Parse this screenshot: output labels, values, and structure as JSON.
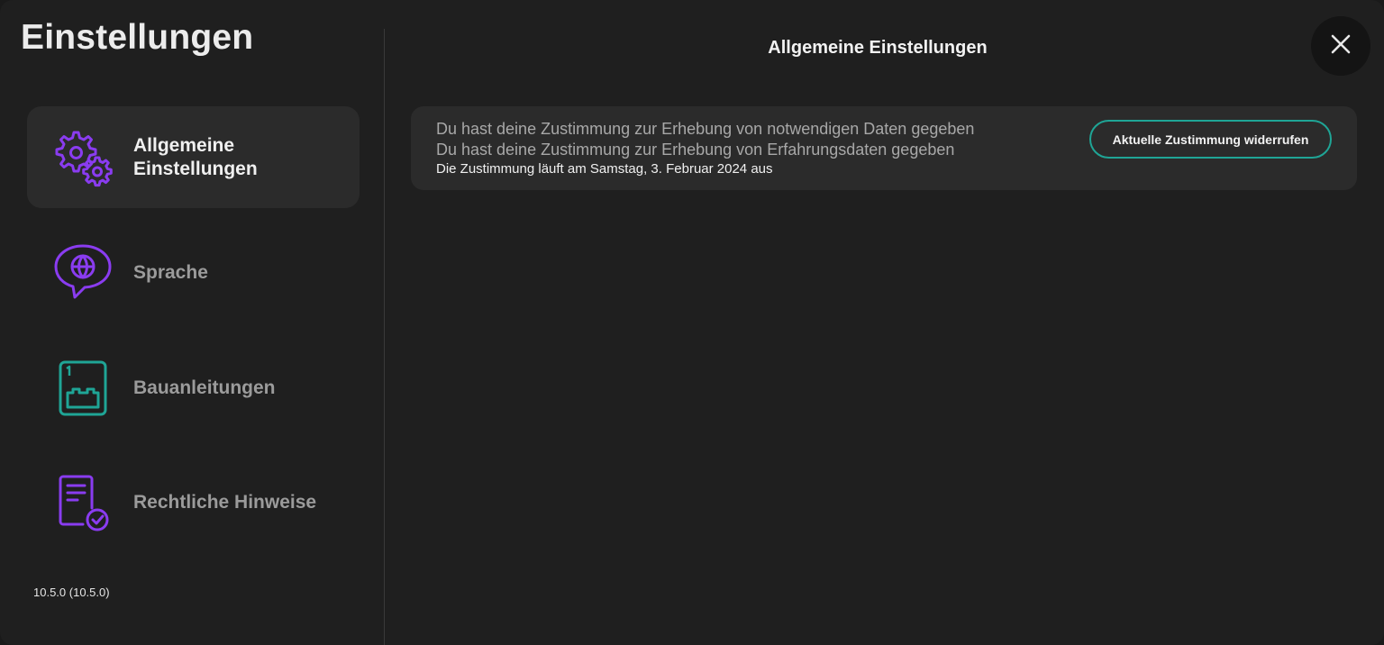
{
  "page": {
    "title": "Einstellungen",
    "version": "10.5.0 (10.5.0)"
  },
  "sidebar": {
    "items": [
      {
        "label": "Allgemeine Einstellungen",
        "icon": "gears-icon",
        "active": true
      },
      {
        "label": "Sprache",
        "icon": "globe-chat-icon",
        "active": false
      },
      {
        "label": "Bauanleitungen",
        "icon": "building-instructions-icon",
        "active": false
      },
      {
        "label": "Rechtliche Hinweise",
        "icon": "legal-document-icon",
        "active": false
      }
    ]
  },
  "main": {
    "section_title": "Allgemeine Einstellungen",
    "close_icon": "close-icon",
    "consent": {
      "line1": "Du hast deine Zustimmung zur Erhebung von notwendigen Daten gegeben",
      "line2": "Du hast deine Zustimmung zur Erhebung von Erfahrungsdaten gegeben",
      "expiry": "Die Zustimmung läuft am Samstag, 3. Februar 2024 aus",
      "revoke_label": "Aktuelle Zustimmung widerrufen"
    }
  },
  "colors": {
    "background": "#1f1f1f",
    "panel": "#2b2b2b",
    "accent_purple": "#8a3cf0",
    "accent_teal": "#1fa596"
  }
}
